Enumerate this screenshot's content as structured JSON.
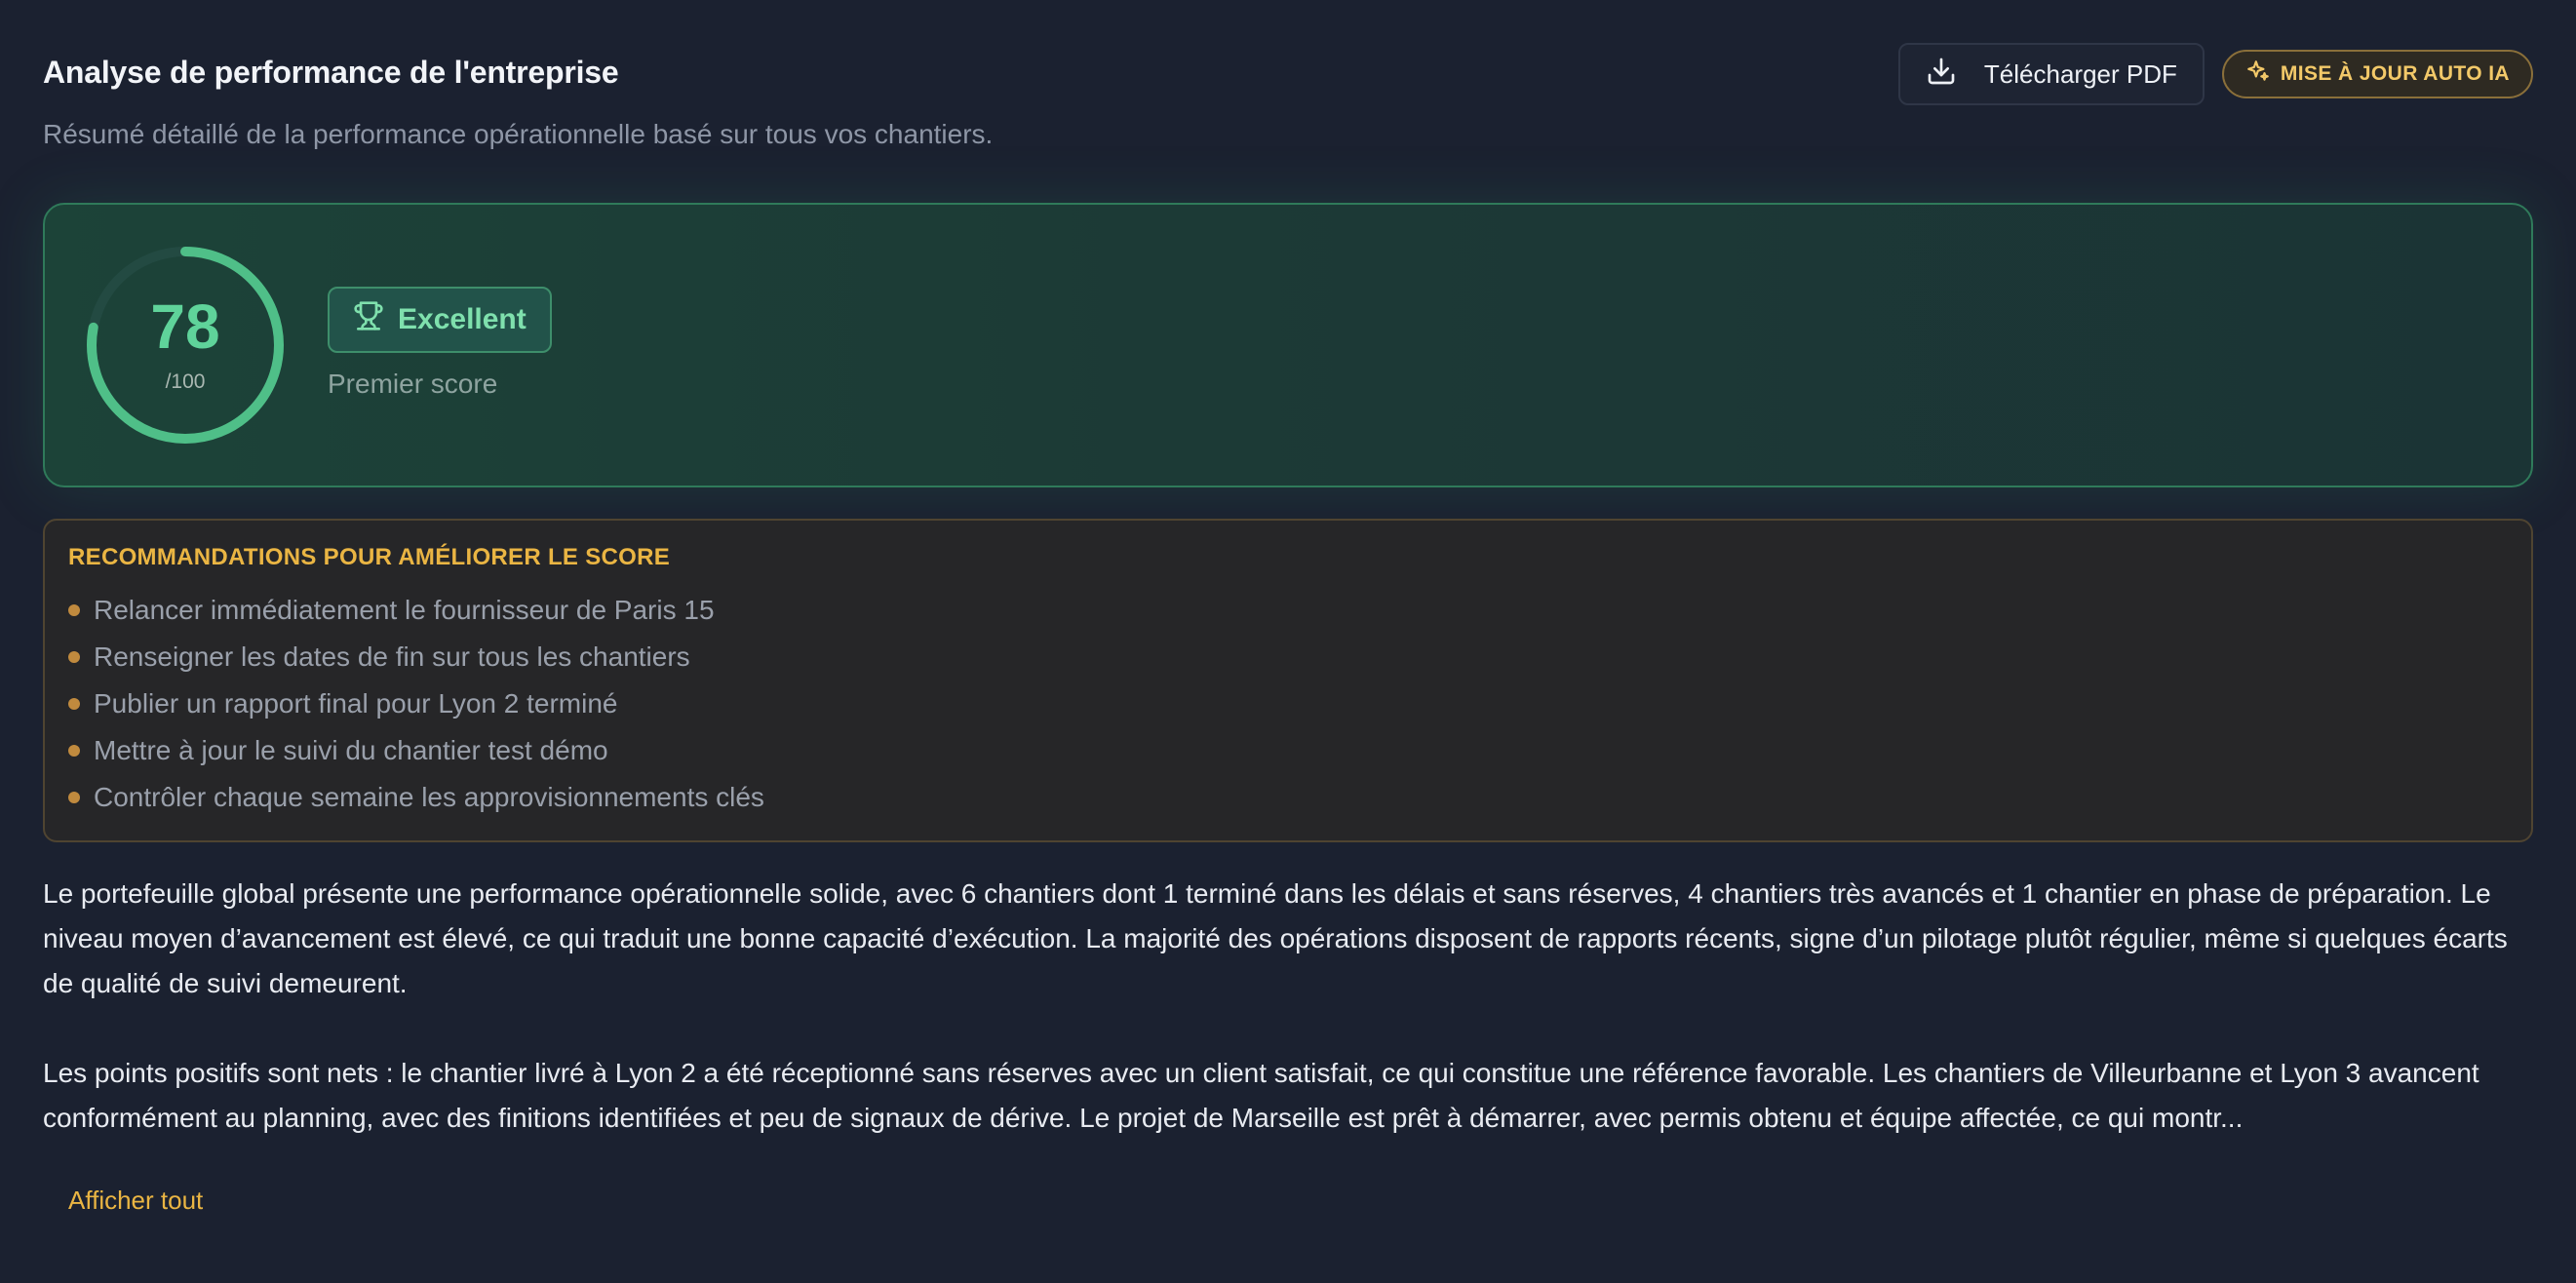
{
  "header": {
    "title": "Analyse de performance de l'entreprise",
    "subtitle": "Résumé détaillé de la performance opérationnelle basé sur tous vos chantiers.",
    "download_label": "Télécharger PDF",
    "download_icon": "download-icon",
    "ai_update_label": "MISE À JOUR AUTO IA",
    "ai_update_icon": "sparkles-icon"
  },
  "score": {
    "value": "78",
    "max_label": "/100",
    "fraction": 0.78,
    "rating_label": "Excellent",
    "rating_icon": "trophy-icon",
    "caption": "Premier score",
    "color": "#5fd39a"
  },
  "recommendations": {
    "title": "RECOMMANDATIONS POUR AMÉLIORER LE SCORE",
    "items": [
      "Relancer immédiatement le fournisseur de Paris 15",
      "Renseigner les dates de fin sur tous les chantiers",
      "Publier un rapport final pour Lyon 2 terminé",
      "Mettre à jour le suivi du chantier test démo",
      "Contrôler chaque semaine les approvisionnements clés"
    ]
  },
  "summary": {
    "paragraphs": [
      "Le portefeuille global présente une performance opérationnelle solide, avec 6 chantiers dont 1 terminé dans les délais et sans réserves, 4 chantiers très avancés et 1 chantier en phase de préparation. Le niveau moyen d’avancement est élevé, ce qui traduit une bonne capacité d’exécution. La majorité des opérations disposent de rapports récents, signe d’un pilotage plutôt régulier, même si quelques écarts de qualité de suivi demeurent.",
      "Les points positifs sont nets : le chantier livré à Lyon 2 a été réceptionné sans réserves avec un client satisfait, ce qui constitue une référence favorable. Les chantiers de Villeurbanne et Lyon 3 avancent conformément au planning, avec des finitions identifiées et peu de signaux de dérive. Le projet de Marseille est prêt à démarrer, avec permis obtenu et équipe affectée, ce qui montr..."
    ],
    "show_all_label": "Afficher tout"
  }
}
